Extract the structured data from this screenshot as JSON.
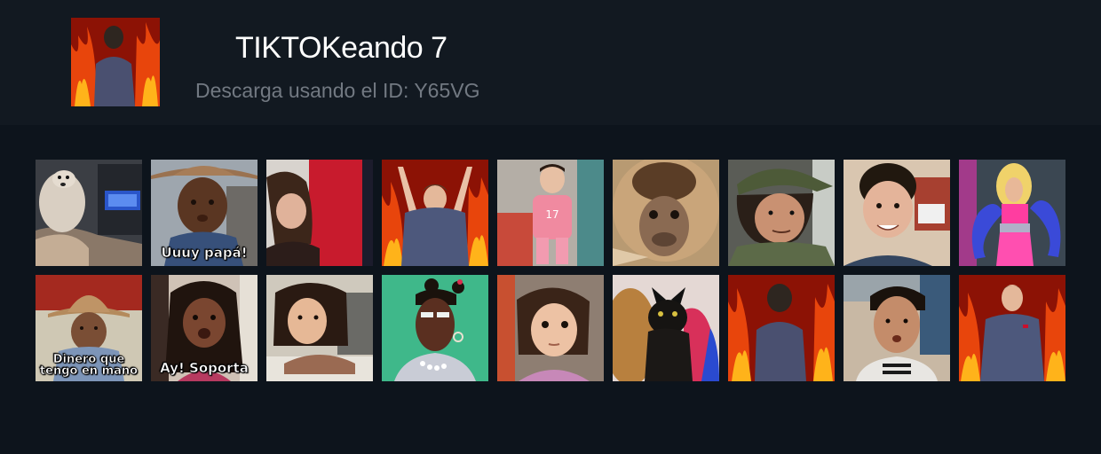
{
  "header": {
    "title": "TIKTOKeando 7",
    "subtitle": "Descarga usando el ID: Y65VG"
  },
  "stickers": [
    {
      "name": "dog",
      "caption": ""
    },
    {
      "name": "boy-cowboy-hat",
      "caption": "Uuuy papá!"
    },
    {
      "name": "girl-dancing",
      "caption": ""
    },
    {
      "name": "man-arms-up-fire",
      "caption": ""
    },
    {
      "name": "toddler-pink",
      "caption": ""
    },
    {
      "name": "monkey",
      "caption": ""
    },
    {
      "name": "boy-cap",
      "caption": ""
    },
    {
      "name": "boy-smiling",
      "caption": ""
    },
    {
      "name": "dancer-pink",
      "caption": ""
    },
    {
      "name": "boy-hat-sign",
      "caption": "Dinero que tengo en mano"
    },
    {
      "name": "girl-braids",
      "caption": "Ay! Soporta"
    },
    {
      "name": "girl-table",
      "caption": ""
    },
    {
      "name": "person-green-bg",
      "caption": ""
    },
    {
      "name": "girl-pink-sweater",
      "caption": ""
    },
    {
      "name": "cats",
      "caption": ""
    },
    {
      "name": "man-back-fire",
      "caption": ""
    },
    {
      "name": "boy-selfie",
      "caption": ""
    },
    {
      "name": "man-fire-sweater",
      "caption": ""
    }
  ],
  "colors": {
    "background": "#0d141c",
    "header_background": "#121921",
    "title": "#ffffff",
    "subtitle": "#727982"
  }
}
